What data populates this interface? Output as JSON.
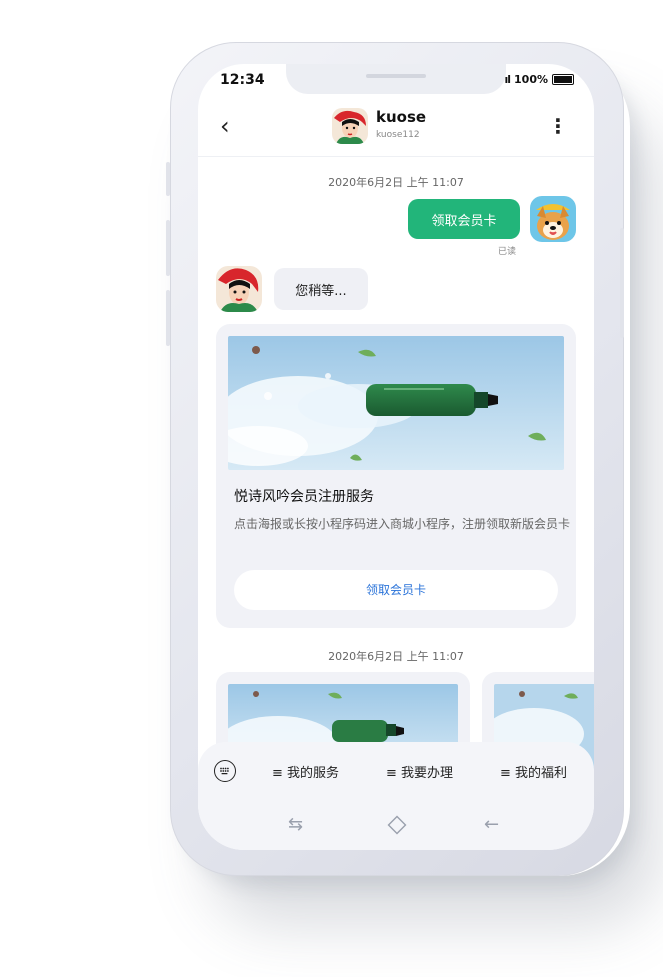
{
  "status": {
    "time": "12:34",
    "signal": "ıl",
    "battery": "100%"
  },
  "header": {
    "name": "kuose",
    "handle": "kuose112"
  },
  "chat": {
    "timestamp_1": "2020年6月2日  上午  11:07",
    "my_message": "领取会员卡",
    "read_receipt": "已读",
    "bot_message": "您稍等...",
    "card": {
      "title": "悦诗风吟会员注册服务",
      "description": "点击海报或长按小程序码进入商城小程序，注册领取新版会员卡",
      "button": "领取会员卡"
    },
    "timestamp_2": "2020年6月2日  上午  11:07"
  },
  "bottom_menu": {
    "items": [
      "≡ 我的服务",
      "≡ 我要办理",
      "≡ 我的福利"
    ]
  },
  "colors": {
    "accent_green": "#22b57a",
    "link_blue": "#2a73d9"
  }
}
